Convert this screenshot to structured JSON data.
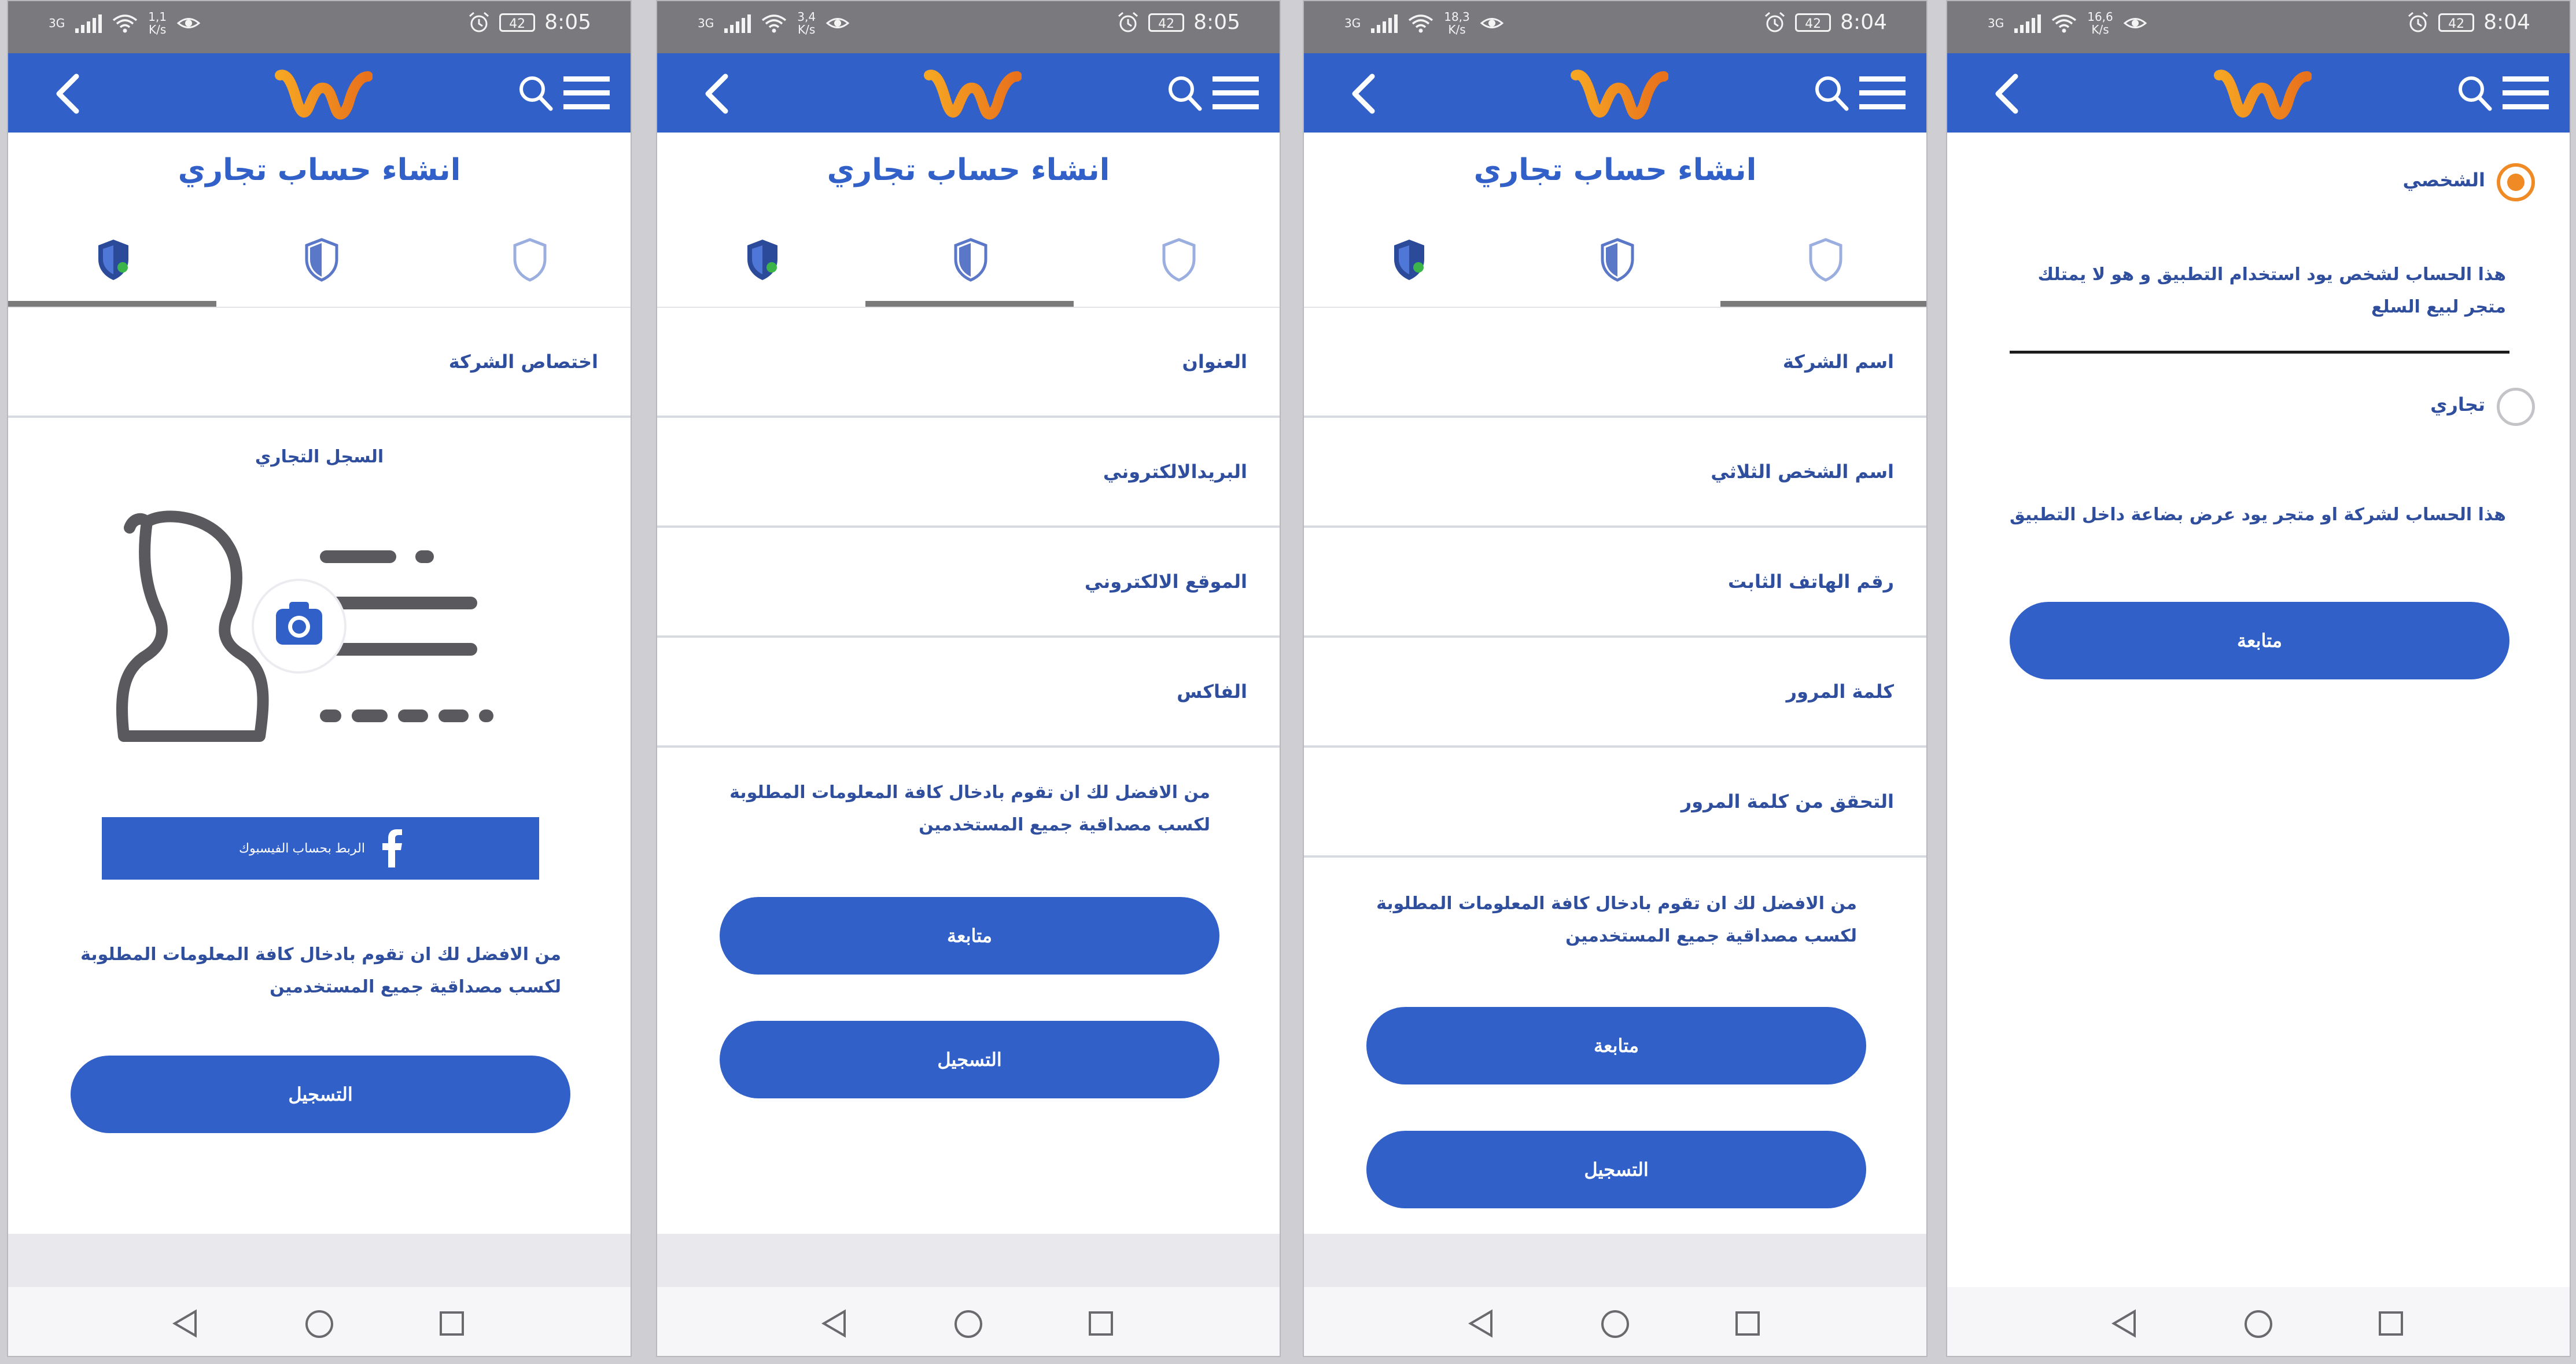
{
  "status_bars": [
    {
      "network": "3G",
      "speed": "1,1\nK/s",
      "battery": "42",
      "time": "8:05"
    },
    {
      "network": "3G",
      "speed": "3,4\nK/s",
      "battery": "42",
      "time": "8:05"
    },
    {
      "network": "3G",
      "speed": "18,3\nK/s",
      "battery": "42",
      "time": "8:04"
    },
    {
      "network": "3G",
      "speed": "16,6\nK/s",
      "battery": "42",
      "time": "8:04"
    }
  ],
  "brand": {
    "appbar_color": "#3060c8",
    "logo_colors": [
      "#f6a623",
      "#e8711c"
    ],
    "accent_orange": "#f08a24",
    "text_blue": "#2f4f9e"
  },
  "screen1": {
    "title": "انشاء حساب تجاري",
    "active_step": 1,
    "fields": [
      "اختصاص الشركة"
    ],
    "section_label": "السجل  التجاري",
    "facebook_button": "الربط بحساب الفيسبوك",
    "info_text": "من الافضل لك ان تقوم بادخال كافة المعلومات المطلوبة لكسب مصداقية جميع المستخدمين",
    "register_button": "التسجيل"
  },
  "screen2": {
    "title": "انشاء حساب تجاري",
    "active_step": 2,
    "fields": [
      "العنوان",
      "البريدالالكتروني",
      "الموقع الالكتروني",
      "الفاكس"
    ],
    "info_text": "من الافضل لك ان تقوم بادخال كافة المعلومات المطلوبة لكسب مصداقية جميع المستخدمين",
    "continue_button": "متابعة",
    "register_button": "التسجيل"
  },
  "screen3": {
    "title": "انشاء حساب تجاري",
    "active_step": 3,
    "fields": [
      "اسم الشركة",
      "اسم الشخص الثلاثي",
      "رقم الهاتف الثابت",
      "كلمة المرور",
      "التحقق من كلمة المرور"
    ],
    "info_text": "من الافضل لك ان تقوم بادخال كافة المعلومات المطلوبة لكسب مصداقية جميع المستخدمين",
    "continue_button": "متابعة",
    "register_button": "التسجيل"
  },
  "screen4": {
    "options": [
      {
        "label": "الشخصي",
        "selected": true,
        "description": "هذا الحساب لشخص يود استخدام التطبيق و هو لا يمتلك متجر لبيع السلع"
      },
      {
        "label": "تجاري",
        "selected": false,
        "description": "هذا الحساب لشركة او متجر يود عرض بضاعة داخل التطبيق"
      }
    ],
    "continue_button": "متابعة"
  },
  "icons": {
    "back": "chevron-left-icon",
    "search": "search-icon",
    "menu": "hamburger-menu-icon",
    "step": "shield-icon",
    "camera": "camera-icon",
    "facebook": "facebook-icon"
  }
}
